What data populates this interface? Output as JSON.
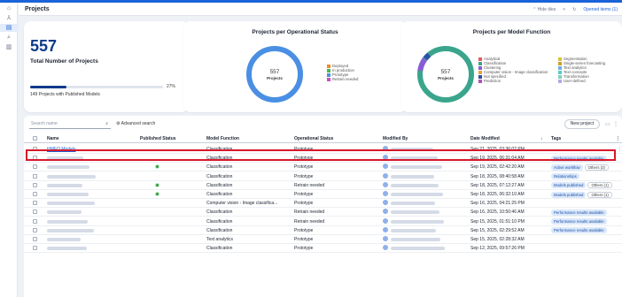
{
  "header": {
    "title": "Projects",
    "hide_tiles": "Hide tiles",
    "opened_items": "Opened items (1)"
  },
  "nav_icons": [
    "home-icon",
    "hierarchy-icon",
    "projects-icon",
    "search-data-icon",
    "library-icon"
  ],
  "kpi": {
    "value": "557",
    "label": "Total Number of Projects",
    "progress_percent": 27,
    "percent_label": "27%",
    "published_label": "149 Projects with Published Models"
  },
  "status_chart": {
    "title": "Projects per Operational Status",
    "center_value": "557",
    "center_label": "Projects",
    "legend": [
      {
        "label": "Deployed",
        "color": "#f08a24"
      },
      {
        "label": "In production",
        "color": "#4bb84b"
      },
      {
        "label": "Prototype",
        "color": "#4a8fe3"
      },
      {
        "label": "Retrain needed",
        "color": "#c74fc7"
      }
    ]
  },
  "model_chart": {
    "title": "Projects per Model Function",
    "center_value": "557",
    "center_label": "Projects",
    "legend": [
      {
        "label": "Analytical",
        "color": "#e85a5a"
      },
      {
        "label": "Classification",
        "color": "#3aa58c"
      },
      {
        "label": "Clustering",
        "color": "#8a5bd8"
      },
      {
        "label": "Computer vision - Image classification",
        "color": "#e8a13a"
      },
      {
        "label": "Not specified",
        "color": "#2e4fa8"
      },
      {
        "label": "Prediction",
        "color": "#b04fc0"
      },
      {
        "label": "Segmentation",
        "color": "#d6c33a"
      },
      {
        "label": "Single-series forecasting",
        "color": "#c9a227"
      },
      {
        "label": "Text analytics",
        "color": "#6ab0e8"
      },
      {
        "label": "Text concepts",
        "color": "#5bc9c9"
      },
      {
        "label": "Transformation",
        "color": "#7fd1b9"
      },
      {
        "label": "User-defined",
        "color": "#b9a6e6"
      }
    ]
  },
  "toolbar": {
    "search_placeholder": "Search name",
    "advanced": "Advanced search",
    "new_project": "New project"
  },
  "columns": {
    "name": "Name",
    "published": "Published Status",
    "function": "Model Function",
    "status": "Operational Status",
    "modified_by": "Modified By",
    "date": "Date Modified",
    "tags": "Tags"
  },
  "rows": [
    {
      "name": "HMEQ Models",
      "published": false,
      "function": "Classification",
      "status": "Prototype",
      "date": "Sep 21, 2025, 03:36:02 PM",
      "tags": []
    },
    {
      "name": "",
      "published": false,
      "function": "Classification",
      "status": "Prototype",
      "date": "Sep 19, 2025, 06:31:04 AM",
      "tags": [
        "Performance results available"
      ]
    },
    {
      "name": "",
      "published": true,
      "function": "Classification",
      "status": "Prototype",
      "date": "Sep 19, 2025, 02:42:20 AM",
      "tags": [
        "Active workflow",
        "Others (2)"
      ]
    },
    {
      "name": "",
      "published": false,
      "function": "Classification",
      "status": "Prototype",
      "date": "Sep 18, 2025, 08:40:58 AM",
      "tags": [
        "Relationships"
      ]
    },
    {
      "name": "",
      "published": true,
      "function": "Classification",
      "status": "Retrain needed",
      "date": "Sep 18, 2025, 07:12:27 AM",
      "tags": [
        "Models published",
        "Others (1)"
      ]
    },
    {
      "name": "",
      "published": true,
      "function": "Classification",
      "status": "Prototype",
      "date": "Sep 18, 2025, 06:32:10 AM",
      "tags": [
        "Models published",
        "Others (1)"
      ]
    },
    {
      "name": "",
      "published": false,
      "function": "Computer vision - Image classifica...",
      "status": "Prototype",
      "date": "Sep 16, 2025, 04:21:25 PM",
      "tags": []
    },
    {
      "name": "",
      "published": false,
      "function": "Classification",
      "status": "Retrain needed",
      "date": "Sep 16, 2025, 10:50:46 AM",
      "tags": [
        "Performance results available"
      ]
    },
    {
      "name": "",
      "published": false,
      "function": "Classification",
      "status": "Retrain needed",
      "date": "Sep 15, 2025, 01:51:10 PM",
      "tags": [
        "Performance results available"
      ]
    },
    {
      "name": "",
      "published": false,
      "function": "Classification",
      "status": "Prototype",
      "date": "Sep 15, 2025, 02:29:52 AM",
      "tags": [
        "Performance results available"
      ]
    },
    {
      "name": "",
      "published": false,
      "function": "Text analytics",
      "status": "Prototype",
      "date": "Sep 15, 2025, 02:28:32 AM",
      "tags": []
    },
    {
      "name": "",
      "published": false,
      "function": "Classification",
      "status": "Prototype",
      "date": "Sep 12, 2025, 09:57:26 PM",
      "tags": []
    }
  ]
}
